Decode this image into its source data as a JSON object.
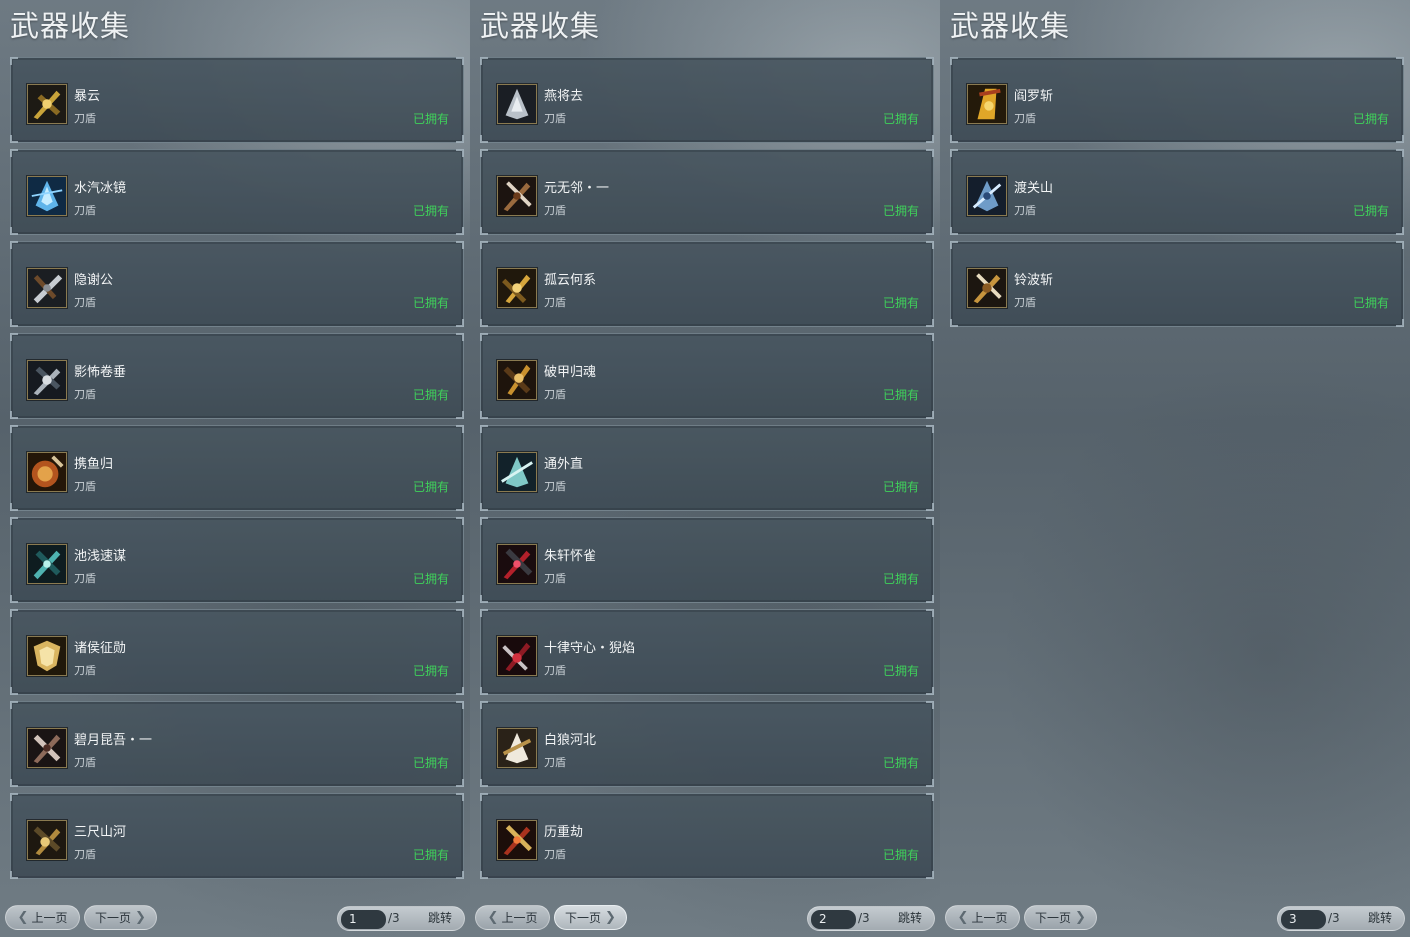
{
  "panels": [
    {
      "title": "武器收集",
      "items": [
        {
          "name": "暴云",
          "type": "刀盾",
          "status": "已拥有",
          "icon": "gold-blade-weapon-icon"
        },
        {
          "name": "水汽冰镜",
          "type": "刀盾",
          "status": "已拥有",
          "icon": "ice-crystal-shield-icon"
        },
        {
          "name": "隐谢公",
          "type": "刀盾",
          "status": "已拥有",
          "icon": "silver-blade-weapon-icon"
        },
        {
          "name": "影怖卷垂",
          "type": "刀盾",
          "status": "已拥有",
          "icon": "silver-blade-weapon-icon"
        },
        {
          "name": "携鱼归",
          "type": "刀盾",
          "status": "已拥有",
          "icon": "bronze-round-shield-icon"
        },
        {
          "name": "池浅速谋",
          "type": "刀盾",
          "status": "已拥有",
          "icon": "teal-blade-weapon-icon"
        },
        {
          "name": "诸侯征勋",
          "type": "刀盾",
          "status": "已拥有",
          "icon": "gold-shield-weapon-icon"
        },
        {
          "name": "碧月昆吾・一",
          "type": "刀盾",
          "status": "已拥有",
          "icon": "dark-blade-weapon-icon"
        },
        {
          "name": "三尺山河",
          "type": "刀盾",
          "status": "已拥有",
          "icon": "gold-blade-weapon-icon"
        }
      ],
      "pager": {
        "prev": "上一页",
        "next": "下一页",
        "current": "1",
        "total": "/3",
        "jump": "跳转"
      }
    },
    {
      "title": "武器收集",
      "items": [
        {
          "name": "燕将去",
          "type": "刀盾",
          "status": "已拥有",
          "icon": "silver-blade-weapon-icon"
        },
        {
          "name": "元无邻・一",
          "type": "刀盾",
          "status": "已拥有",
          "icon": "dark-blade-weapon-icon"
        },
        {
          "name": "孤云何系",
          "type": "刀盾",
          "status": "已拥有",
          "icon": "gold-blade-weapon-icon"
        },
        {
          "name": "破甲归魂",
          "type": "刀盾",
          "status": "已拥有",
          "icon": "gold-blade-weapon-icon"
        },
        {
          "name": "通外直",
          "type": "刀盾",
          "status": "已拥有",
          "icon": "teal-blade-weapon-icon"
        },
        {
          "name": "朱轩怀雀",
          "type": "刀盾",
          "status": "已拥有",
          "icon": "crimson-blade-weapon-icon"
        },
        {
          "name": "十律守心・猊焰",
          "type": "刀盾",
          "status": "已拥有",
          "icon": "crimson-blade-weapon-icon"
        },
        {
          "name": "白狼河北",
          "type": "刀盾",
          "status": "已拥有",
          "icon": "white-blade-weapon-icon"
        },
        {
          "name": "历重劫",
          "type": "刀盾",
          "status": "已拥有",
          "icon": "crimson-blade-weapon-icon"
        }
      ],
      "pager": {
        "prev": "上一页",
        "next": "下一页",
        "current": "2",
        "total": "/3",
        "jump": "跳转"
      }
    },
    {
      "title": "武器收集",
      "items": [
        {
          "name": "阎罗斩",
          "type": "刀盾",
          "status": "已拥有",
          "icon": "gold-blade-weapon-icon"
        },
        {
          "name": "渡关山",
          "type": "刀盾",
          "status": "已拥有",
          "icon": "ice-crystal-shield-icon"
        },
        {
          "name": "铃波斩",
          "type": "刀盾",
          "status": "已拥有",
          "icon": "gold-blade-weapon-icon"
        }
      ],
      "pager": {
        "prev": "上一页",
        "next": "下一页",
        "current": "3",
        "total": "/3",
        "jump": "跳转"
      }
    }
  ],
  "colors": {
    "owned_green": "#3fd15a",
    "title_white": "#eef1f3",
    "card_bg": "#46545e"
  }
}
